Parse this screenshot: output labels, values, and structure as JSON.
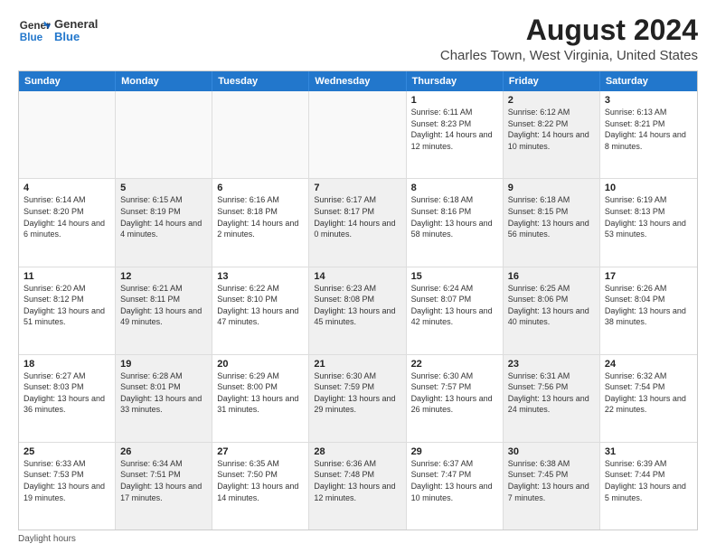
{
  "logo": {
    "line1": "General",
    "line2": "Blue"
  },
  "title": "August 2024",
  "subtitle": "Charles Town, West Virginia, United States",
  "weekdays": [
    "Sunday",
    "Monday",
    "Tuesday",
    "Wednesday",
    "Thursday",
    "Friday",
    "Saturday"
  ],
  "weeks": [
    [
      {
        "day": "",
        "sunrise": "",
        "sunset": "",
        "daylight": "",
        "shaded": false,
        "empty": true
      },
      {
        "day": "",
        "sunrise": "",
        "sunset": "",
        "daylight": "",
        "shaded": false,
        "empty": true
      },
      {
        "day": "",
        "sunrise": "",
        "sunset": "",
        "daylight": "",
        "shaded": false,
        "empty": true
      },
      {
        "day": "",
        "sunrise": "",
        "sunset": "",
        "daylight": "",
        "shaded": false,
        "empty": true
      },
      {
        "day": "1",
        "sunrise": "Sunrise: 6:11 AM",
        "sunset": "Sunset: 8:23 PM",
        "daylight": "Daylight: 14 hours and 12 minutes.",
        "shaded": false,
        "empty": false
      },
      {
        "day": "2",
        "sunrise": "Sunrise: 6:12 AM",
        "sunset": "Sunset: 8:22 PM",
        "daylight": "Daylight: 14 hours and 10 minutes.",
        "shaded": true,
        "empty": false
      },
      {
        "day": "3",
        "sunrise": "Sunrise: 6:13 AM",
        "sunset": "Sunset: 8:21 PM",
        "daylight": "Daylight: 14 hours and 8 minutes.",
        "shaded": false,
        "empty": false
      }
    ],
    [
      {
        "day": "4",
        "sunrise": "Sunrise: 6:14 AM",
        "sunset": "Sunset: 8:20 PM",
        "daylight": "Daylight: 14 hours and 6 minutes.",
        "shaded": false,
        "empty": false
      },
      {
        "day": "5",
        "sunrise": "Sunrise: 6:15 AM",
        "sunset": "Sunset: 8:19 PM",
        "daylight": "Daylight: 14 hours and 4 minutes.",
        "shaded": true,
        "empty": false
      },
      {
        "day": "6",
        "sunrise": "Sunrise: 6:16 AM",
        "sunset": "Sunset: 8:18 PM",
        "daylight": "Daylight: 14 hours and 2 minutes.",
        "shaded": false,
        "empty": false
      },
      {
        "day": "7",
        "sunrise": "Sunrise: 6:17 AM",
        "sunset": "Sunset: 8:17 PM",
        "daylight": "Daylight: 14 hours and 0 minutes.",
        "shaded": true,
        "empty": false
      },
      {
        "day": "8",
        "sunrise": "Sunrise: 6:18 AM",
        "sunset": "Sunset: 8:16 PM",
        "daylight": "Daylight: 13 hours and 58 minutes.",
        "shaded": false,
        "empty": false
      },
      {
        "day": "9",
        "sunrise": "Sunrise: 6:18 AM",
        "sunset": "Sunset: 8:15 PM",
        "daylight": "Daylight: 13 hours and 56 minutes.",
        "shaded": true,
        "empty": false
      },
      {
        "day": "10",
        "sunrise": "Sunrise: 6:19 AM",
        "sunset": "Sunset: 8:13 PM",
        "daylight": "Daylight: 13 hours and 53 minutes.",
        "shaded": false,
        "empty": false
      }
    ],
    [
      {
        "day": "11",
        "sunrise": "Sunrise: 6:20 AM",
        "sunset": "Sunset: 8:12 PM",
        "daylight": "Daylight: 13 hours and 51 minutes.",
        "shaded": false,
        "empty": false
      },
      {
        "day": "12",
        "sunrise": "Sunrise: 6:21 AM",
        "sunset": "Sunset: 8:11 PM",
        "daylight": "Daylight: 13 hours and 49 minutes.",
        "shaded": true,
        "empty": false
      },
      {
        "day": "13",
        "sunrise": "Sunrise: 6:22 AM",
        "sunset": "Sunset: 8:10 PM",
        "daylight": "Daylight: 13 hours and 47 minutes.",
        "shaded": false,
        "empty": false
      },
      {
        "day": "14",
        "sunrise": "Sunrise: 6:23 AM",
        "sunset": "Sunset: 8:08 PM",
        "daylight": "Daylight: 13 hours and 45 minutes.",
        "shaded": true,
        "empty": false
      },
      {
        "day": "15",
        "sunrise": "Sunrise: 6:24 AM",
        "sunset": "Sunset: 8:07 PM",
        "daylight": "Daylight: 13 hours and 42 minutes.",
        "shaded": false,
        "empty": false
      },
      {
        "day": "16",
        "sunrise": "Sunrise: 6:25 AM",
        "sunset": "Sunset: 8:06 PM",
        "daylight": "Daylight: 13 hours and 40 minutes.",
        "shaded": true,
        "empty": false
      },
      {
        "day": "17",
        "sunrise": "Sunrise: 6:26 AM",
        "sunset": "Sunset: 8:04 PM",
        "daylight": "Daylight: 13 hours and 38 minutes.",
        "shaded": false,
        "empty": false
      }
    ],
    [
      {
        "day": "18",
        "sunrise": "Sunrise: 6:27 AM",
        "sunset": "Sunset: 8:03 PM",
        "daylight": "Daylight: 13 hours and 36 minutes.",
        "shaded": false,
        "empty": false
      },
      {
        "day": "19",
        "sunrise": "Sunrise: 6:28 AM",
        "sunset": "Sunset: 8:01 PM",
        "daylight": "Daylight: 13 hours and 33 minutes.",
        "shaded": true,
        "empty": false
      },
      {
        "day": "20",
        "sunrise": "Sunrise: 6:29 AM",
        "sunset": "Sunset: 8:00 PM",
        "daylight": "Daylight: 13 hours and 31 minutes.",
        "shaded": false,
        "empty": false
      },
      {
        "day": "21",
        "sunrise": "Sunrise: 6:30 AM",
        "sunset": "Sunset: 7:59 PM",
        "daylight": "Daylight: 13 hours and 29 minutes.",
        "shaded": true,
        "empty": false
      },
      {
        "day": "22",
        "sunrise": "Sunrise: 6:30 AM",
        "sunset": "Sunset: 7:57 PM",
        "daylight": "Daylight: 13 hours and 26 minutes.",
        "shaded": false,
        "empty": false
      },
      {
        "day": "23",
        "sunrise": "Sunrise: 6:31 AM",
        "sunset": "Sunset: 7:56 PM",
        "daylight": "Daylight: 13 hours and 24 minutes.",
        "shaded": true,
        "empty": false
      },
      {
        "day": "24",
        "sunrise": "Sunrise: 6:32 AM",
        "sunset": "Sunset: 7:54 PM",
        "daylight": "Daylight: 13 hours and 22 minutes.",
        "shaded": false,
        "empty": false
      }
    ],
    [
      {
        "day": "25",
        "sunrise": "Sunrise: 6:33 AM",
        "sunset": "Sunset: 7:53 PM",
        "daylight": "Daylight: 13 hours and 19 minutes.",
        "shaded": false,
        "empty": false
      },
      {
        "day": "26",
        "sunrise": "Sunrise: 6:34 AM",
        "sunset": "Sunset: 7:51 PM",
        "daylight": "Daylight: 13 hours and 17 minutes.",
        "shaded": true,
        "empty": false
      },
      {
        "day": "27",
        "sunrise": "Sunrise: 6:35 AM",
        "sunset": "Sunset: 7:50 PM",
        "daylight": "Daylight: 13 hours and 14 minutes.",
        "shaded": false,
        "empty": false
      },
      {
        "day": "28",
        "sunrise": "Sunrise: 6:36 AM",
        "sunset": "Sunset: 7:48 PM",
        "daylight": "Daylight: 13 hours and 12 minutes.",
        "shaded": true,
        "empty": false
      },
      {
        "day": "29",
        "sunrise": "Sunrise: 6:37 AM",
        "sunset": "Sunset: 7:47 PM",
        "daylight": "Daylight: 13 hours and 10 minutes.",
        "shaded": false,
        "empty": false
      },
      {
        "day": "30",
        "sunrise": "Sunrise: 6:38 AM",
        "sunset": "Sunset: 7:45 PM",
        "daylight": "Daylight: 13 hours and 7 minutes.",
        "shaded": true,
        "empty": false
      },
      {
        "day": "31",
        "sunrise": "Sunrise: 6:39 AM",
        "sunset": "Sunset: 7:44 PM",
        "daylight": "Daylight: 13 hours and 5 minutes.",
        "shaded": false,
        "empty": false
      }
    ]
  ],
  "footer": "Daylight hours"
}
